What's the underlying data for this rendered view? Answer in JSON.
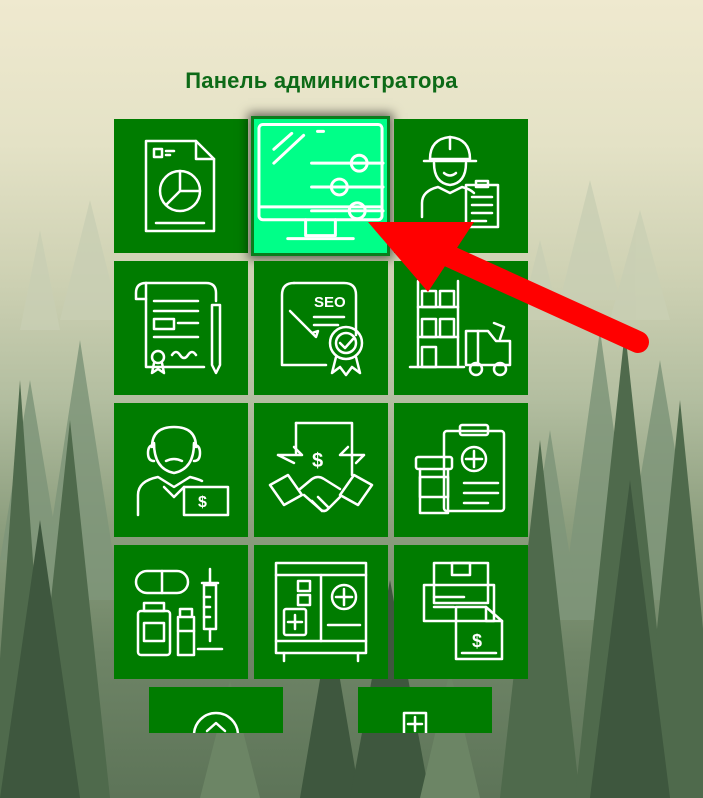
{
  "page": {
    "title": "Панель администратора"
  },
  "tiles": [
    {
      "icon": "document-pie-chart-icon",
      "active": false
    },
    {
      "icon": "monitor-settings-sliders-icon",
      "active": true
    },
    {
      "icon": "engineer-clipboard-icon",
      "active": false
    },
    {
      "icon": "certificate-contract-icon",
      "active": false
    },
    {
      "icon": "seo-certificate-icon",
      "active": false
    },
    {
      "icon": "warehouse-forklift-icon",
      "active": false
    },
    {
      "icon": "cashier-payment-icon",
      "active": false
    },
    {
      "icon": "deal-handshake-icon",
      "active": false
    },
    {
      "icon": "medicine-clipboard-icon",
      "active": false
    },
    {
      "icon": "pharmacy-drugs-syringe-icon",
      "active": false
    },
    {
      "icon": "pharmacy-cabinet-icon",
      "active": false
    },
    {
      "icon": "invoice-delivery-icon",
      "active": false
    },
    {
      "icon": "medical-emblem-icon",
      "active": false
    },
    {
      "icon": "first-aid-plus-icon",
      "active": false
    }
  ],
  "colors": {
    "tile": "#007c00",
    "tile_active": "#00ff88",
    "title": "#0d6a17",
    "arrow": "#ff0000"
  }
}
